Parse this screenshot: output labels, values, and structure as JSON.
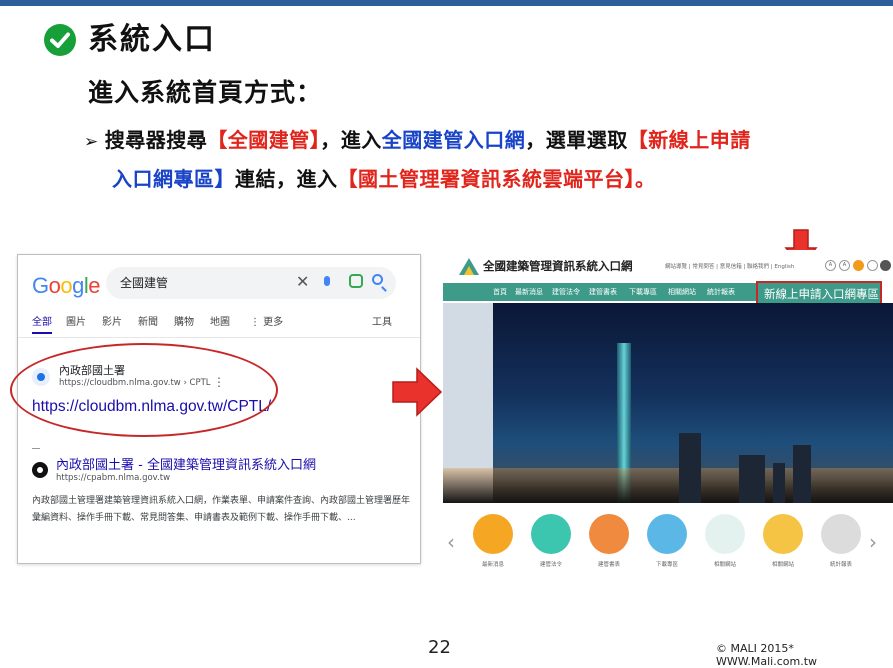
{
  "slide": {
    "title": "系統入口",
    "subtitle": "進入系統首頁方式：",
    "bullet": {
      "t1": "搜尋器搜尋",
      "t2": "【全國建管】",
      "t3": "，進入",
      "t4": "全國建管入口網",
      "t5": "，選單選取",
      "t6": "【新線上申請",
      "t7": "入口網專區】",
      "t8": "連結，進入",
      "t9": "【國土管理署資訊系統雲端平台】",
      "t10": "。"
    },
    "page_number": "22",
    "copyright": "© MALI 2015* WWW.Mali.com.tw"
  },
  "google": {
    "logo": "Google",
    "query": "全國建管",
    "tabs": [
      "全部",
      "圖片",
      "影片",
      "新聞",
      "購物",
      "地圖",
      "⋮ 更多"
    ],
    "tools": "工具",
    "result1": {
      "site": "內政部國土署",
      "url": "https://cloudbm.nlma.gov.tw › CPTL",
      "link": "https://cloudbm.nlma.gov.tw/CPTL/"
    },
    "result2": {
      "title": "內政部國土署 - 全國建築管理資訊系統入口網",
      "url": "https://cpabm.nlma.gov.tw",
      "desc": "內政部國土管理署建築管理資訊系統入口網，作業表單、申請案件查詢、內政部國土管理署歷年彙編資料、操作手冊下載、常見問答集、申請書表及範例下載、操作手冊下載、..."
    }
  },
  "website": {
    "title": "全國建築管理資訊系統入口網",
    "top_links": "網站導覽 | 常見問答 | 意見信箱 | 聯絡我們 | English",
    "nav": [
      "首頁",
      "最新消息",
      "建管法令",
      "建管書表",
      "下載專區",
      "相關網站",
      "統計報表"
    ],
    "highlight": "新線上申請入口網專區",
    "icon_labels": [
      "最新消息",
      "建管法令",
      "建管書表",
      "下載專區",
      "相關網站",
      "相關網站",
      "統計報表"
    ]
  },
  "colors": {
    "accent_blue": "#1a44c8",
    "accent_red": "#e0261c",
    "check_green": "#17a03a",
    "nav_teal": "#3e9b8a"
  }
}
